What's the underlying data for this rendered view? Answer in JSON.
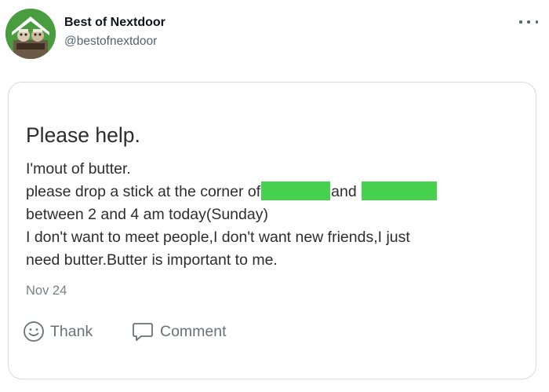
{
  "header": {
    "display_name": "Best of Nextdoor",
    "handle": "@bestofnextdoor"
  },
  "post": {
    "title": "Please help.",
    "line1": "I'mout of butter.",
    "line2_a": "please drop a stick at the corner of",
    "line2_b": "and",
    "line3": "between 2 and 4 am today(Sunday)",
    "line4": "I don't want to meet people,I don't want new friends,I just",
    "line5": "need butter.Butter is important to me.",
    "date": "Nov 24",
    "redaction_color": "#46d14e"
  },
  "actions": {
    "thank_label": "Thank",
    "comment_label": "Comment"
  },
  "colors": {
    "name": "#0f1419",
    "handle": "#536471",
    "body_text": "#2d2d2d",
    "muted": "#7a7f85",
    "border": "#d6dbe0",
    "avatar_green": "#4a9d3e"
  }
}
